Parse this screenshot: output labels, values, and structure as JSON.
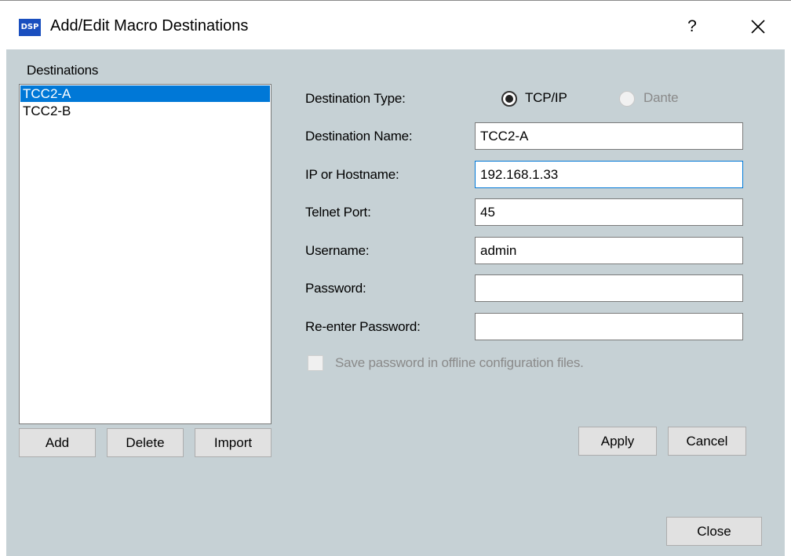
{
  "window": {
    "app_icon_text": "DSP",
    "title": "Add/Edit Macro Destinations",
    "help_label": "?",
    "close_icon": "close-x-icon"
  },
  "destinations": {
    "label": "Destinations",
    "items": [
      "TCC2-A",
      "TCC2-B"
    ],
    "selected": "TCC2-A",
    "buttons": {
      "add": "Add",
      "delete": "Delete",
      "import": "Import"
    }
  },
  "form": {
    "destination_type_label": "Destination Type:",
    "type_options": {
      "tcpip": "TCP/IP",
      "dante": "Dante"
    },
    "selected_type": "TCP/IP",
    "destination_name_label": "Destination Name:",
    "destination_name_value": "TCC2-A",
    "ip_label": "IP or Hostname:",
    "ip_value": "192.168.1.33",
    "telnet_port_label": "Telnet Port:",
    "telnet_port_value": "45",
    "username_label": "Username:",
    "username_value": "admin",
    "password_label": "Password:",
    "password_value": "",
    "reenter_password_label": "Re-enter Password:",
    "reenter_password_value": "",
    "save_password_label": "Save password in offline configuration files.",
    "save_password_checked": false,
    "apply_label": "Apply",
    "cancel_label": "Cancel"
  },
  "footer": {
    "close_label": "Close"
  },
  "colors": {
    "client_bg": "#c6d1d5",
    "selection": "#0078d7",
    "app_icon": "#1a4fbf"
  }
}
